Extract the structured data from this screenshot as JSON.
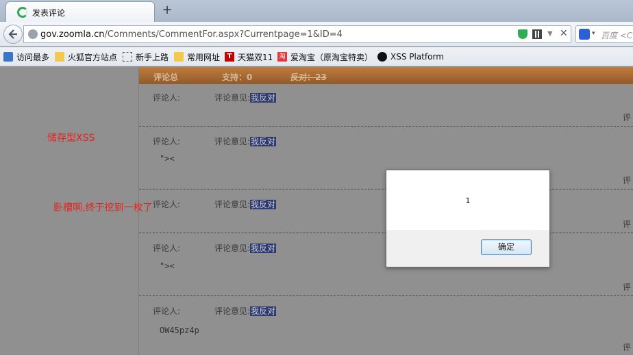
{
  "browser": {
    "tab_title": "发表评论",
    "new_tab": "+",
    "url_domain": "gov.zoomla.cn",
    "url_prefix": "",
    "url_path": "/Comments/CommentFor.aspx?Currentpage=1&ID=4",
    "search_placeholder": "百度 <C"
  },
  "bookmarks": [
    {
      "label": "访问最多",
      "icon": "most-visited-icon"
    },
    {
      "label": "火狐官方站点",
      "icon": "folder-icon"
    },
    {
      "label": "新手上路",
      "icon": "dotted-page-icon"
    },
    {
      "label": "常用网址",
      "icon": "folder-icon"
    },
    {
      "label": "天猫双11",
      "icon": "tmall-icon"
    },
    {
      "label": "爱淘宝（原淘宝特卖）",
      "icon": "taobao-icon"
    },
    {
      "label": "XSS Platform",
      "icon": "skull-icon"
    }
  ],
  "header": {
    "summary": "评论总",
    "support": "支持：0",
    "oppose": "反对：23"
  },
  "annotations": {
    "stored_xss": "储存型XSS",
    "exclaim": "卧槽啊,终于挖到一枚了"
  },
  "comments": [
    {
      "author_label": "评论人:",
      "opinion_label": "评论意见:",
      "opinion": "我反对",
      "body": "",
      "right": "评"
    },
    {
      "author_label": "评论人:",
      "opinion_label": "评论意见:",
      "opinion": "我反对",
      "body": "\">< ",
      "right": "评"
    },
    {
      "author_label": "评论人:",
      "opinion_label": "评论意见:",
      "opinion": "我反对",
      "body": "",
      "right": "评"
    },
    {
      "author_label": "评论人:",
      "opinion_label": "评论意见:",
      "opinion": "我反对",
      "body": "\">< ",
      "right": "评"
    },
    {
      "author_label": "评论人:",
      "opinion_label": "评论意见:",
      "opinion": "我反对",
      "body": "OW45pz4p",
      "right": "评"
    }
  ],
  "dialog": {
    "message": "1",
    "ok_label": "确定"
  }
}
